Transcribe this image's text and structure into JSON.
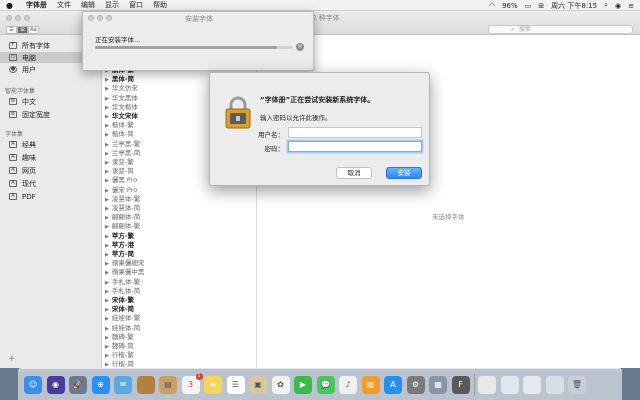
{
  "menubar": {
    "app_name": "字体册",
    "menus": [
      "文件",
      "编辑",
      "显示",
      "窗口",
      "帮助"
    ],
    "battery": "96%",
    "clock": "周六 下午8:15"
  },
  "main_window": {
    "title_suffix": "2 种字体",
    "search_placeholder": "搜索",
    "view_buttons": [
      "☰",
      "⊞",
      "Aa"
    ],
    "no_selection": "未选择字体"
  },
  "sidebar": {
    "items_top": [
      {
        "label": "所有字体",
        "icon": "font-icon",
        "selected": false
      },
      {
        "label": "电脑",
        "icon": "computer-icon",
        "selected": true
      },
      {
        "label": "用户",
        "icon": "user-icon",
        "selected": false
      }
    ],
    "smart_heading": "智能字体集",
    "smart_items": [
      {
        "label": "中文",
        "icon": "collection-icon"
      },
      {
        "label": "固定宽度",
        "icon": "collection-icon"
      }
    ],
    "collections_heading": "字体集",
    "collections": [
      {
        "label": "经典",
        "icon": "collection-icon"
      },
      {
        "label": "趣味",
        "icon": "collection-icon"
      },
      {
        "label": "网页",
        "icon": "collection-icon"
      },
      {
        "label": "现代",
        "icon": "collection-icon"
      },
      {
        "label": "PDF",
        "icon": "collection-icon"
      }
    ],
    "add_label": "+"
  },
  "font_list": [
    {
      "name": "黑体-繁",
      "style": "bold"
    },
    {
      "name": "黑体-简",
      "style": "bold"
    },
    {
      "name": "华文仿宋",
      "style": "light"
    },
    {
      "name": "华文黑体",
      "style": "light"
    },
    {
      "name": "华文楷体",
      "style": "light"
    },
    {
      "name": "华文宋体",
      "style": "bold"
    },
    {
      "name": "楷体-繁",
      "style": "light"
    },
    {
      "name": "楷体-简",
      "style": "light"
    },
    {
      "name": "兰亭黑-繁",
      "style": "light"
    },
    {
      "name": "兰亭黑-简",
      "style": "light"
    },
    {
      "name": "隶变-繁",
      "style": "light"
    },
    {
      "name": "隶变-简",
      "style": "light"
    },
    {
      "name": "儷黑 Pro",
      "style": "light"
    },
    {
      "name": "儷宋 Pro",
      "style": "light"
    },
    {
      "name": "凌慧体-繁",
      "style": "light"
    },
    {
      "name": "凌慧体-简",
      "style": "light"
    },
    {
      "name": "翩翩体-简",
      "style": "light"
    },
    {
      "name": "翩翩体-繁",
      "style": "light"
    },
    {
      "name": "苹方-繁",
      "style": "bold"
    },
    {
      "name": "苹方-港",
      "style": "bold"
    },
    {
      "name": "苹方-简",
      "style": "bold"
    },
    {
      "name": "蘋果儷細宋",
      "style": "light"
    },
    {
      "name": "蘋果儷中黑",
      "style": "light"
    },
    {
      "name": "手札体-繁",
      "style": "light"
    },
    {
      "name": "手札体-简",
      "style": "light"
    },
    {
      "name": "宋体-繁",
      "style": "bold"
    },
    {
      "name": "宋体-简",
      "style": "bold"
    },
    {
      "name": "娃娃体-繁",
      "style": "light"
    },
    {
      "name": "娃娃体-简",
      "style": "light"
    },
    {
      "name": "魏碑-繁",
      "style": "light"
    },
    {
      "name": "魏碑-简",
      "style": "light"
    },
    {
      "name": "行楷-繁",
      "style": "light"
    },
    {
      "name": "行楷-简",
      "style": "light"
    }
  ],
  "install_window": {
    "title": "安装字体",
    "message": "正在安装字体...",
    "progress": 0.92,
    "cancel_glyph": "×"
  },
  "auth_dialog": {
    "title": "“字体册”正在尝试安装新系统字体。",
    "subtitle": "输入密码以允许此操作。",
    "username_label": "用户名：",
    "username_value": "",
    "password_label": "密码：",
    "password_value": "",
    "cancel_label": "取消",
    "ok_label": "安装"
  },
  "dock": {
    "apps": [
      {
        "name": "finder-icon",
        "color": "#3a8ee6",
        "glyph": "☺"
      },
      {
        "name": "siri-icon",
        "color": "#4a3a9a",
        "glyph": "◉"
      },
      {
        "name": "launchpad-icon",
        "color": "#6a7a90",
        "glyph": "🚀"
      },
      {
        "name": "safari-icon",
        "color": "#2a8ff0",
        "glyph": "⊕"
      },
      {
        "name": "mail-icon",
        "color": "#5aa8e8",
        "glyph": "✉"
      },
      {
        "name": "notes-wood-icon",
        "color": "#b5803d",
        "glyph": ""
      },
      {
        "name": "contacts-icon",
        "color": "#c9a067",
        "glyph": "▤"
      },
      {
        "name": "calendar-icon",
        "color": "#f4f4f4",
        "glyph": "3"
      },
      {
        "name": "notes-icon",
        "color": "#f6d65a",
        "glyph": "≡"
      },
      {
        "name": "reminders-icon",
        "color": "#ffffff",
        "glyph": "☰"
      },
      {
        "name": "preview-icon",
        "color": "#d8c8a0",
        "glyph": "▣"
      },
      {
        "name": "photos-icon",
        "color": "#f2f2f2",
        "glyph": "✿"
      },
      {
        "name": "facetime-icon",
        "color": "#3cba4a",
        "glyph": "▶"
      },
      {
        "name": "messages-icon",
        "color": "#42c95a",
        "glyph": "💬"
      },
      {
        "name": "music-icon",
        "color": "#f0f0f0",
        "glyph": "♪"
      },
      {
        "name": "books-icon",
        "color": "#f39a2a",
        "glyph": "▥"
      },
      {
        "name": "appstore-icon",
        "color": "#2a8ef0",
        "glyph": "A"
      },
      {
        "name": "system-preferences-icon",
        "color": "#7a7a7a",
        "glyph": "⚙"
      },
      {
        "name": "image-capture-icon",
        "color": "#8a96a8",
        "glyph": "▦"
      },
      {
        "name": "font-book-icon",
        "color": "#5a5a5a",
        "glyph": "F"
      }
    ],
    "docs": [
      {
        "name": "document-icon",
        "color": "#e8e8e8",
        "glyph": ""
      },
      {
        "name": "document-icon",
        "color": "#dfe6f0",
        "glyph": ""
      },
      {
        "name": "document-icon",
        "color": "#e6eaf0",
        "glyph": ""
      },
      {
        "name": "document-icon",
        "color": "#d8dde6",
        "glyph": ""
      },
      {
        "name": "trash-icon",
        "color": "#c9ced6",
        "glyph": "🗑"
      }
    ],
    "calendar_badge": "1"
  }
}
